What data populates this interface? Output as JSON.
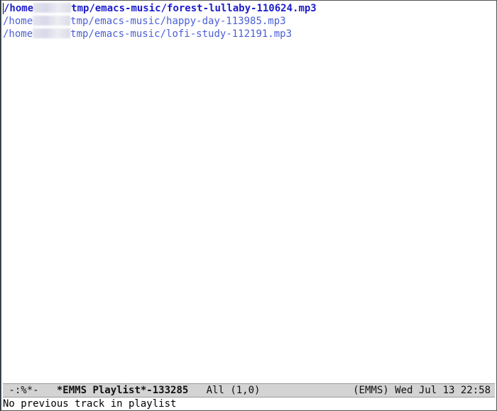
{
  "playlist": {
    "tracks": [
      {
        "prefix": "/home",
        "suffix": "tmp/emacs-music/forest-lullaby-110624.mp3",
        "current": true
      },
      {
        "prefix": "/home",
        "suffix": "tmp/emacs-music/happy-day-113985.mp3",
        "current": false
      },
      {
        "prefix": "/home",
        "suffix": "tmp/emacs-music/lofi-study-112191.mp3",
        "current": false
      }
    ]
  },
  "modeline": {
    "status": " -:%*-  ",
    "buffer_name": "*EMMS Playlist*-133285",
    "position": "All (1,0)",
    "mode": "(EMMS)",
    "datetime": "Wed Jul 13 22:58"
  },
  "echo_area": "No previous track in playlist",
  "colors": {
    "track": "#4b5fd6",
    "current_track": "#1c1ccd",
    "modeline_bg": "#d3d3d3"
  }
}
